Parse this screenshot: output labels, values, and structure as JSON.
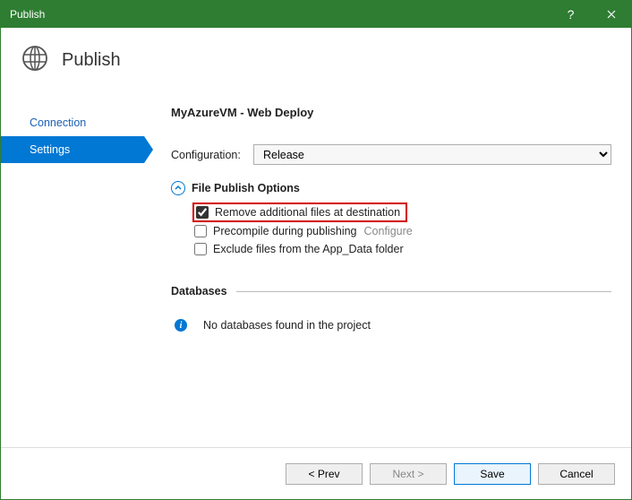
{
  "window": {
    "title": "Publish"
  },
  "header": {
    "title": "Publish"
  },
  "sidebar": {
    "items": [
      {
        "label": "Connection",
        "active": false
      },
      {
        "label": "Settings",
        "active": true
      }
    ]
  },
  "main": {
    "title": "MyAzureVM - Web Deploy",
    "configuration_label": "Configuration:",
    "configuration_value": "Release",
    "file_publish_options_label": "File Publish Options",
    "options": {
      "remove_additional": {
        "label": "Remove additional files at destination",
        "checked": true
      },
      "precompile": {
        "label": "Precompile during publishing",
        "checked": false,
        "configure_label": "Configure"
      },
      "exclude_appdata": {
        "label": "Exclude files from the App_Data folder",
        "checked": false
      }
    },
    "databases_label": "Databases",
    "databases_message": "No databases found in the project"
  },
  "footer": {
    "prev": "< Prev",
    "next": "Next >",
    "save": "Save",
    "cancel": "Cancel"
  }
}
